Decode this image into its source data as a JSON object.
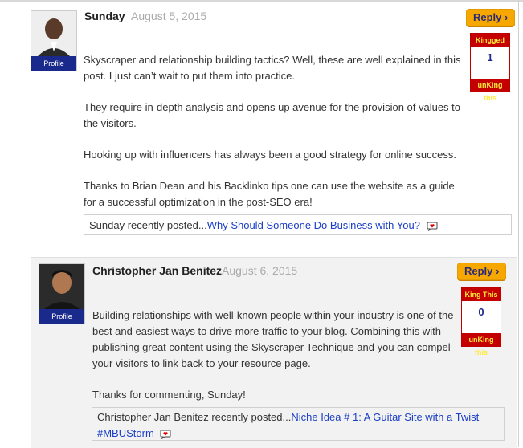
{
  "comments": [
    {
      "author": "Sunday",
      "date": "August 5, 2015",
      "reply": "Reply ›",
      "profile": "Profile",
      "king_top": "Kingged",
      "king_count": "1",
      "king_bottom": "unKing this",
      "paragraphs": [
        "Skyscraper and relationship building tactics? Well, these are well explained in this post. I just can’t wait to put them into practice.",
        "They require in-depth analysis and opens up avenue for the provision of values to the visitors.",
        "Hooking up with influencers has always been a good strategy for online success.",
        "Thanks to Brian Dean and his Backlinko tips one can use the website as a guide for a successful optimization in the post-SEO era!"
      ],
      "recent_prefix": "Sunday recently posted...",
      "recent_link": "Why Should Someone Do Business with You?"
    },
    {
      "author": "Christopher Jan Benitez",
      "date": "August 6, 2015",
      "reply": "Reply ›",
      "profile": "Profile",
      "king_top": "King This",
      "king_count": "0",
      "king_bottom": "unKing this",
      "paragraphs": [
        "Building relationships with well-known people within your industry is one of the best and easiest ways to drive more traffic to your blog. Combining this with publishing great content using the Skyscraper Technique and you can compel your visitors to link back to your resource page.",
        "Thanks for commenting, Sunday!"
      ],
      "recent_prefix": "Christopher Jan Benitez recently posted...",
      "recent_link": "Niche Idea # 1: A Guitar Site with a Twist #MBUStorm"
    }
  ],
  "colors": {
    "reply": "#f6a800",
    "king": "#c40000",
    "link": "#1b3ec6",
    "profile": "#1a2a8c"
  },
  "icons": {
    "heart": "heart-speech-icon"
  }
}
